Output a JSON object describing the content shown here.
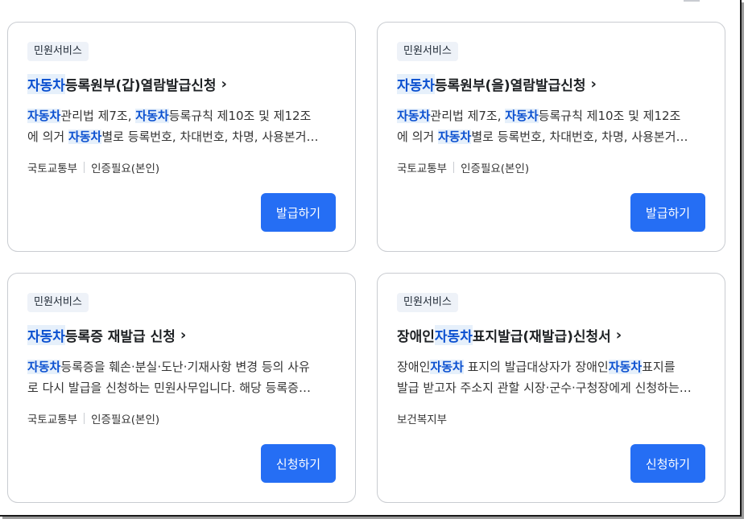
{
  "cards": [
    {
      "badge": "민원서비스",
      "title": {
        "hl": "자동차",
        "rest": "등록원부(갑)열람발급신청"
      },
      "desc": [
        [
          {
            "t": "자동차",
            "h": true
          },
          {
            "t": "관리법 제7조, "
          },
          {
            "t": "자동차",
            "h": true
          },
          {
            "t": "등록규칙 제10조 및 제12조"
          }
        ],
        [
          {
            "t": "에 의거 "
          },
          {
            "t": "자동차",
            "h": true
          },
          {
            "t": "별로 등록번호, 차대번호, 차명, 사용본거…"
          }
        ]
      ],
      "org": "국토교통부",
      "auth": "인증필요(본인)",
      "button": "발급하기"
    },
    {
      "badge": "민원서비스",
      "title": {
        "hl": "자동차",
        "rest": "등록원부(을)열람발급신청"
      },
      "desc": [
        [
          {
            "t": "자동차",
            "h": true
          },
          {
            "t": "관리법 제7조, "
          },
          {
            "t": "자동차",
            "h": true
          },
          {
            "t": "등록규칙 제10조 및 제12조"
          }
        ],
        [
          {
            "t": "에 의거 "
          },
          {
            "t": "자동차",
            "h": true
          },
          {
            "t": "별로 등록번호, 차대번호, 차명, 사용본거…"
          }
        ]
      ],
      "org": "국토교통부",
      "auth": "인증필요(본인)",
      "button": "발급하기"
    },
    {
      "badge": "민원서비스",
      "title": {
        "hl": "자동차",
        "rest": "등록증 재발급 신청"
      },
      "desc": [
        [
          {
            "t": "자동차",
            "h": true
          },
          {
            "t": "등록증을 훼손·분실·도난·기재사항 변경 등의 사유"
          }
        ],
        [
          {
            "t": "로 다시 발급을 신청하는 민원사무입니다. 해당 등록증…"
          }
        ]
      ],
      "org": "국토교통부",
      "auth": "인증필요(본인)",
      "button": "신청하기"
    },
    {
      "badge": "민원서비스",
      "title": {
        "pre": "장애인",
        "hl": "자동차",
        "rest": "표지발급(재발급)신청서"
      },
      "desc": [
        [
          {
            "t": "장애인"
          },
          {
            "t": "자동차",
            "h": true
          },
          {
            "t": " 표지의 발급대상자가 장애인"
          },
          {
            "t": "자동차",
            "h": true
          },
          {
            "t": "표지를"
          }
        ],
        [
          {
            "t": "발급 받고자 주소지 관할 시장·군수·구청장에게 신청하는…"
          }
        ]
      ],
      "org": "보건복지부",
      "auth": "",
      "button": "신청하기"
    }
  ],
  "icons": {
    "title_arrow": "chevron-right-icon"
  }
}
